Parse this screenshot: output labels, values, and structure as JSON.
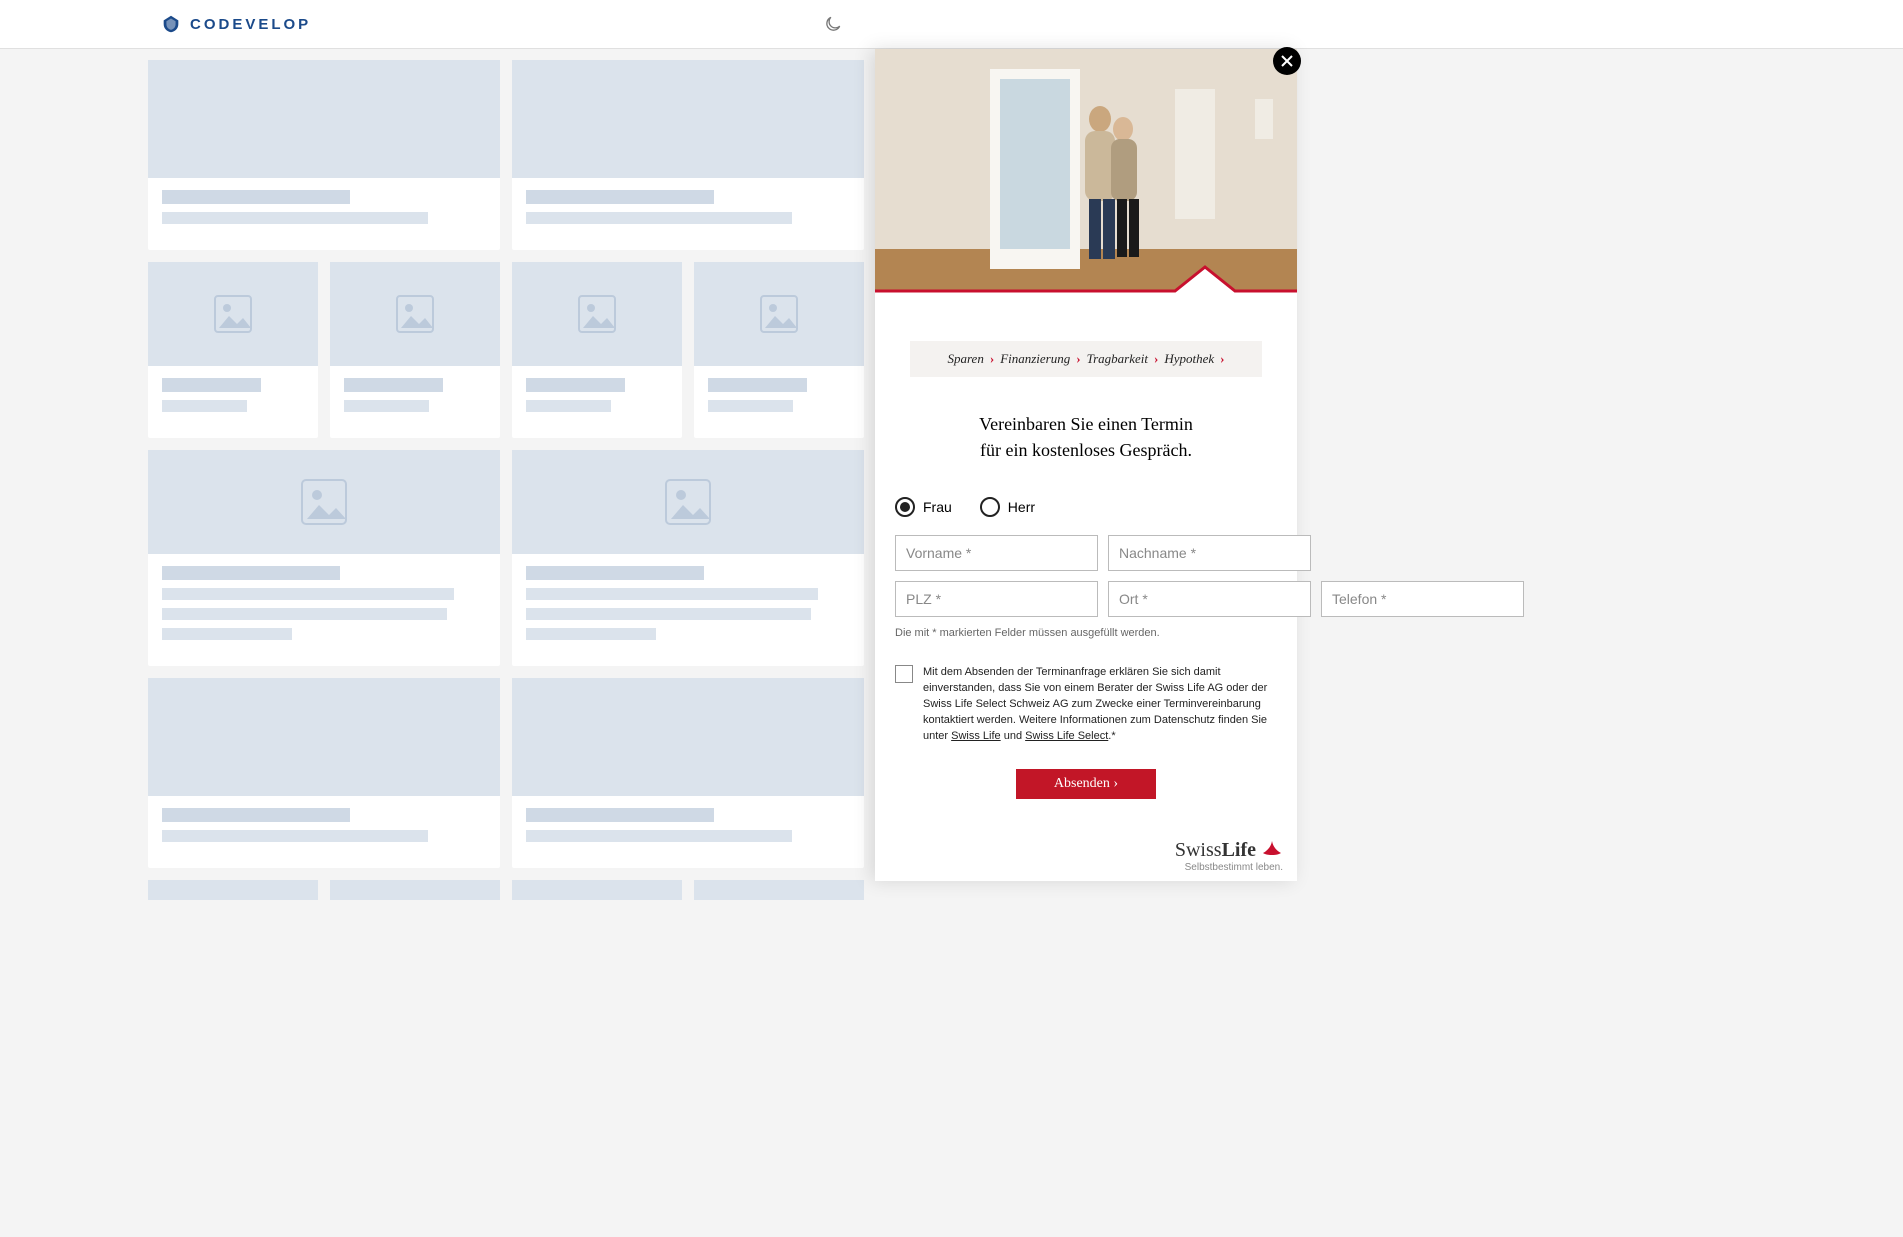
{
  "header": {
    "brand": "CODEVELOP"
  },
  "ad": {
    "steps": [
      "Sparen",
      "Finanzierung",
      "Tragbarkeit",
      "Hypothek"
    ],
    "headline_line1": "Vereinbaren Sie einen Termin",
    "headline_line2": "für ein kostenloses Gespräch.",
    "salutation": {
      "frau": "Frau",
      "herr": "Herr",
      "selected": "frau"
    },
    "placeholders": {
      "vorname": "Vorname *",
      "nachname": "Nachname *",
      "plz": "PLZ *",
      "ort": "Ort *",
      "telefon": "Telefon *"
    },
    "required_note": "Die mit * markierten Felder müssen ausgefüllt werden.",
    "consent": {
      "pre": "Mit dem Absenden der Terminanfrage erklären Sie sich damit einverstanden, dass Sie von einem Berater der Swiss Life AG oder der Swiss Life Select Schweiz AG zum Zwecke einer Terminvereinbarung kontaktiert werden. Weitere Informationen zum Datenschutz finden Sie unter ",
      "link1": "Swiss Life",
      "mid": " und ",
      "link2": "Swiss Life Select",
      "post": ".*"
    },
    "submit": "Absenden",
    "brand": {
      "name_a": "Swiss",
      "name_b": "Life",
      "tagline": "Selbstbestimmt leben."
    }
  }
}
